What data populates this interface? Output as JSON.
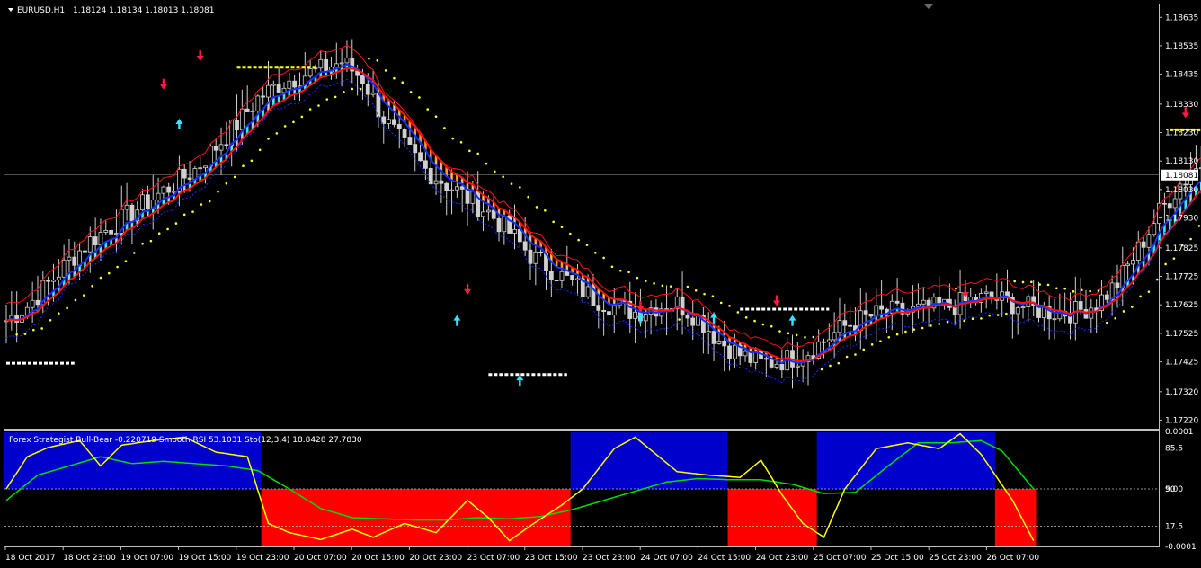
{
  "chart_data": [
    {
      "type": "candlestick",
      "symbol": "EURUSD,H1",
      "header": {
        "symbol": "EURUSD,H1",
        "ohlc": "1.18124 1.18134 1.18013 1.18081"
      },
      "ylim": [
        1.1719,
        1.1868
      ],
      "y_ticks": [
        "1.18635",
        "1.18535",
        "1.18435",
        "1.18330",
        "1.18230",
        "1.18130",
        "1.18081",
        "1.18030",
        "1.17930",
        "1.17825",
        "1.17725",
        "1.17625",
        "1.17525",
        "1.17425",
        "1.17320",
        "1.17220"
      ],
      "current_price": "1.18081",
      "current_price_value": 1.18081,
      "x_ticks": [
        "18 Oct 2017",
        "18 Oct 23:00",
        "19 Oct 07:00",
        "19 Oct 15:00",
        "19 Oct 23:00",
        "20 Oct 07:00",
        "20 Oct 15:00",
        "20 Oct 23:00",
        "23 Oct 07:00",
        "23 Oct 15:00",
        "23 Oct 23:00",
        "24 Oct 07:00",
        "24 Oct 15:00",
        "24 Oct 23:00",
        "25 Oct 07:00",
        "25 Oct 15:00",
        "25 Oct 23:00",
        "26 Oct 07:00"
      ],
      "close_path": [
        [
          0,
          1.1757
        ],
        [
          4,
          1.1762
        ],
        [
          8,
          1.177
        ],
        [
          12,
          1.1778
        ],
        [
          16,
          1.1785
        ],
        [
          20,
          1.179
        ],
        [
          24,
          1.1795
        ],
        [
          28,
          1.18
        ],
        [
          32,
          1.1805
        ],
        [
          36,
          1.181
        ],
        [
          40,
          1.1818
        ],
        [
          44,
          1.1826
        ],
        [
          48,
          1.1835
        ],
        [
          52,
          1.184
        ],
        [
          56,
          1.1843
        ],
        [
          60,
          1.1845
        ],
        [
          64,
          1.1848
        ],
        [
          68,
          1.1842
        ],
        [
          72,
          1.1828
        ],
        [
          76,
          1.1818
        ],
        [
          80,
          1.181
        ],
        [
          84,
          1.1805
        ],
        [
          88,
          1.18
        ],
        [
          92,
          1.1795
        ],
        [
          96,
          1.1788
        ],
        [
          100,
          1.178
        ],
        [
          104,
          1.1775
        ],
        [
          108,
          1.177
        ],
        [
          112,
          1.1765
        ],
        [
          116,
          1.1762
        ],
        [
          120,
          1.176
        ],
        [
          124,
          1.1762
        ],
        [
          128,
          1.1763
        ],
        [
          132,
          1.1758
        ],
        [
          136,
          1.175
        ],
        [
          140,
          1.1745
        ],
        [
          144,
          1.1742
        ],
        [
          148,
          1.1743
        ],
        [
          152,
          1.1745
        ],
        [
          156,
          1.175
        ],
        [
          160,
          1.1755
        ],
        [
          164,
          1.1758
        ],
        [
          168,
          1.176
        ],
        [
          172,
          1.176
        ],
        [
          176,
          1.1761
        ],
        [
          180,
          1.1762
        ],
        [
          184,
          1.1764
        ],
        [
          188,
          1.1765
        ],
        [
          192,
          1.1763
        ],
        [
          196,
          1.1761
        ],
        [
          200,
          1.176
        ],
        [
          204,
          1.176
        ],
        [
          208,
          1.1763
        ],
        [
          212,
          1.177
        ],
        [
          216,
          1.1782
        ],
        [
          220,
          1.1795
        ],
        [
          224,
          1.1805
        ],
        [
          228,
          1.1812
        ],
        [
          232,
          1.1818
        ],
        [
          236,
          1.1822
        ],
        [
          240,
          1.1825
        ],
        [
          244,
          1.1822
        ],
        [
          248,
          1.1816
        ],
        [
          250,
          1.1812
        ]
      ],
      "arrows_down": [
        [
          30,
          1.184
        ],
        [
          37,
          1.185
        ],
        [
          88,
          1.1768
        ],
        [
          121,
          1.1762
        ],
        [
          147,
          1.1764
        ],
        [
          183,
          1.1767
        ],
        [
          225,
          1.183
        ]
      ],
      "arrows_up": [
        [
          33,
          1.1826
        ],
        [
          86,
          1.1757
        ],
        [
          98,
          1.1736
        ],
        [
          121,
          1.1758
        ],
        [
          135,
          1.1758
        ],
        [
          150,
          1.1757
        ]
      ],
      "levels": [
        {
          "x0": 0,
          "x1": 13,
          "y": 1.1742,
          "color": "#ffffff"
        },
        {
          "x0": 44,
          "x1": 59,
          "y": 1.1846,
          "color": "#ffff00"
        },
        {
          "x0": 92,
          "x1": 107,
          "y": 1.1738,
          "color": "#ffffff"
        },
        {
          "x0": 140,
          "x1": 157,
          "y": 1.1761,
          "color": "#ffffff"
        },
        {
          "x0": 222,
          "x1": 232,
          "y": 1.1824,
          "color": "#ffff00"
        }
      ]
    },
    {
      "type": "line",
      "indicator_label": "Forex Strategist Bull-Bear -0.220719  Smooth RSI 53.1031  Sto(12,3,4) 18.8428 27.7830",
      "ylim": [
        0,
        100
      ],
      "y_ticks": [
        "0.0001",
        "85.5",
        "50",
        "9.00",
        "17.5",
        "-0.0001"
      ],
      "regions": [
        {
          "x0": 0,
          "x1": 49,
          "dir": "bull",
          "color": "#0000cc"
        },
        {
          "x0": 49,
          "x1": 108,
          "dir": "bear",
          "color": "#ff0000"
        },
        {
          "x0": 108,
          "x1": 138,
          "dir": "bull",
          "color": "#0000cc"
        },
        {
          "x0": 138,
          "x1": 155,
          "dir": "bear",
          "color": "#ff0000"
        },
        {
          "x0": 155,
          "x1": 189,
          "dir": "bull",
          "color": "#0000cc"
        },
        {
          "x0": 189,
          "x1": 197,
          "dir": "bear",
          "color": "#ff0000"
        }
      ],
      "series": [
        {
          "name": "Smooth RSI",
          "color": "#00dd00",
          "values": [
            [
              0,
              40
            ],
            [
              6,
              62
            ],
            [
              12,
              70
            ],
            [
              18,
              78
            ],
            [
              24,
              72
            ],
            [
              30,
              74
            ],
            [
              36,
              72
            ],
            [
              42,
              70
            ],
            [
              48,
              66
            ],
            [
              54,
              50
            ],
            [
              60,
              33
            ],
            [
              66,
              25
            ],
            [
              72,
              24
            ],
            [
              78,
              23
            ],
            [
              84,
              23
            ],
            [
              90,
              25
            ],
            [
              96,
              24
            ],
            [
              102,
              26
            ],
            [
              108,
              32
            ],
            [
              114,
              40
            ],
            [
              120,
              48
            ],
            [
              126,
              56
            ],
            [
              132,
              59
            ],
            [
              138,
              58
            ],
            [
              144,
              58
            ],
            [
              150,
              54
            ],
            [
              156,
              46
            ],
            [
              162,
              47
            ],
            [
              168,
              69
            ],
            [
              174,
              90
            ],
            [
              180,
              90
            ],
            [
              186,
              92
            ],
            [
              190,
              83
            ],
            [
              196,
              50
            ]
          ]
        },
        {
          "name": "Sto",
          "color": "#ffff00",
          "values": [
            [
              0,
              50
            ],
            [
              4,
              78
            ],
            [
              8,
              86
            ],
            [
              14,
              92
            ],
            [
              18,
              70
            ],
            [
              22,
              88
            ],
            [
              28,
              92
            ],
            [
              34,
              95
            ],
            [
              40,
              82
            ],
            [
              46,
              78
            ],
            [
              50,
              20
            ],
            [
              54,
              12
            ],
            [
              60,
              6
            ],
            [
              66,
              15
            ],
            [
              70,
              8
            ],
            [
              76,
              20
            ],
            [
              82,
              12
            ],
            [
              88,
              40
            ],
            [
              92,
              25
            ],
            [
              96,
              5
            ],
            [
              100,
              18
            ],
            [
              106,
              36
            ],
            [
              110,
              50
            ],
            [
              116,
              85
            ],
            [
              120,
              95
            ],
            [
              124,
              80
            ],
            [
              128,
              65
            ],
            [
              134,
              62
            ],
            [
              140,
              60
            ],
            [
              144,
              75
            ],
            [
              148,
              45
            ],
            [
              152,
              20
            ],
            [
              156,
              8
            ],
            [
              160,
              50
            ],
            [
              166,
              85
            ],
            [
              172,
              90
            ],
            [
              178,
              85
            ],
            [
              182,
              98
            ],
            [
              186,
              80
            ],
            [
              192,
              40
            ],
            [
              196,
              5
            ]
          ]
        }
      ]
    }
  ]
}
